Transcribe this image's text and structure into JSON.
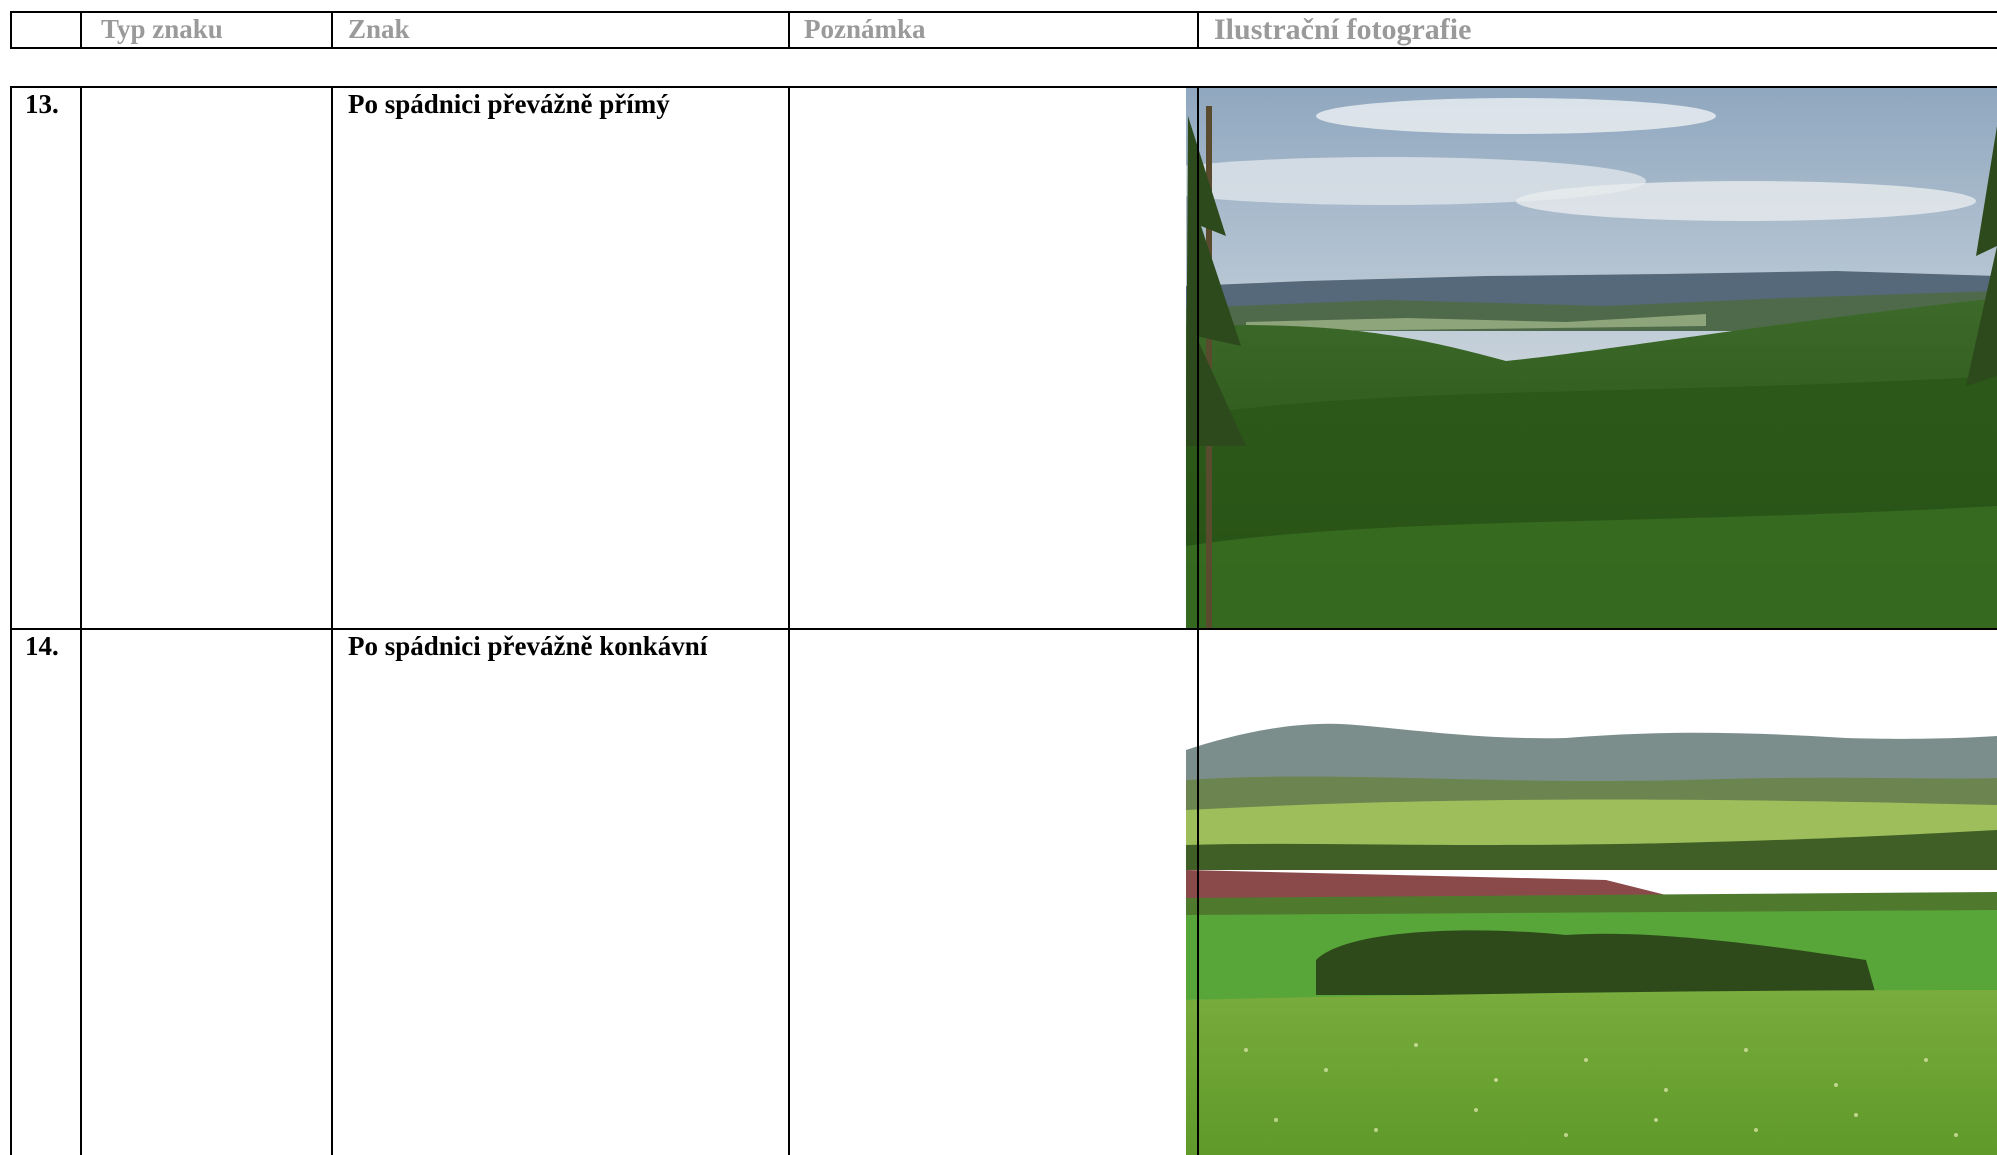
{
  "header": {
    "col_typ": "Typ znaku",
    "col_znak": "Znak",
    "col_poznamka": "Poznámka",
    "col_foto": "Ilustrační fotografie"
  },
  "rows": [
    {
      "number": "13.",
      "typ": "",
      "znak": "Po spádnici převážně přímý",
      "poznamka": "",
      "photo": {
        "icon": "forest-valley-landscape-photo",
        "sky": "#c9d3dc",
        "forest": "#2f5a1e"
      }
    },
    {
      "number": "14.",
      "typ": "",
      "znak": "Po spádnici převážně konkávní",
      "poznamka": "",
      "photo": {
        "icon": "meadow-fields-landscape-photo",
        "sky": "#ffffff",
        "meadow": "#6fa531"
      }
    }
  ]
}
